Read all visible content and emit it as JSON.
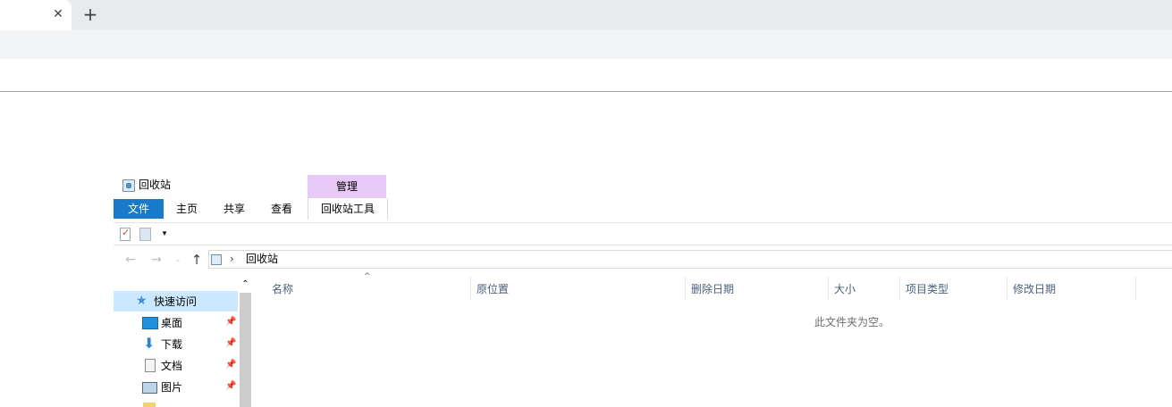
{
  "browser": {
    "tab_close": "✕",
    "new_tab": "+"
  },
  "explorer": {
    "title": "回收站",
    "ribbon": {
      "manage_label": "管理",
      "tools_label": "回收站工具",
      "tabs": [
        "文件",
        "主页",
        "共享",
        "查看"
      ],
      "file_tab_color": "#1979ca",
      "manage_color": "#e7c8f6"
    },
    "quick_access_dropdown": "▾",
    "nav_buttons": {
      "back": "←",
      "forward": "→",
      "recent": "⌄",
      "up": "↑"
    },
    "address": {
      "separator": "›",
      "path": "回收站"
    },
    "nav_pane": {
      "quick_access": "快速访问",
      "items": [
        {
          "label": "桌面",
          "icon": "desktop-icon"
        },
        {
          "label": "下载",
          "icon": "download-icon"
        },
        {
          "label": "文档",
          "icon": "document-icon"
        },
        {
          "label": "图片",
          "icon": "picture-icon"
        }
      ],
      "pin": "📌"
    },
    "columns": [
      "名称",
      "原位置",
      "删除日期",
      "大小",
      "项目类型",
      "修改日期"
    ],
    "sort_indicator": "^",
    "empty_message": "此文件夹为空。"
  }
}
